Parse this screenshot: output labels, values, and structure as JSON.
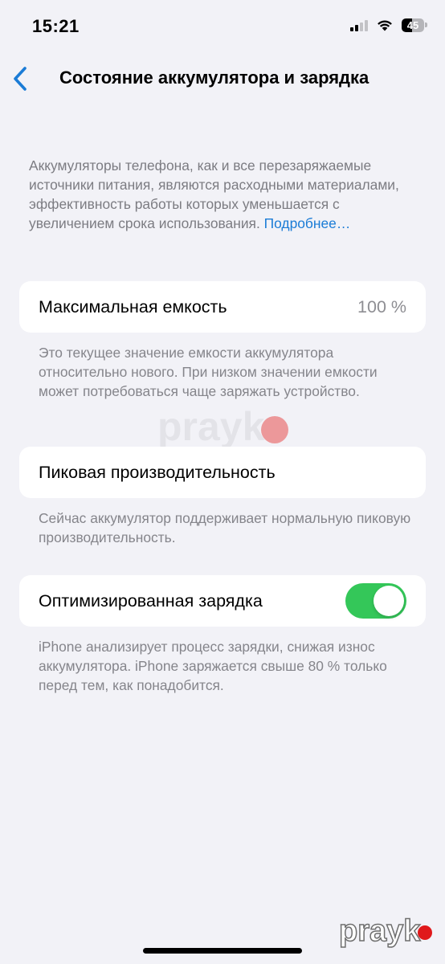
{
  "status_bar": {
    "time": "15:21",
    "battery_level": "45",
    "battery_fraction": 0.45,
    "signal_bars_active": 2,
    "signal_bars_total": 4,
    "icons": [
      "cellular-signal-icon",
      "wifi-icon",
      "battery-icon"
    ]
  },
  "nav": {
    "back_icon": "chevron-left-icon",
    "title": "Состояние аккумулятора и зарядка"
  },
  "intro": {
    "text": "Аккумуляторы телефона, как и все перезаряжаемые источники питания, являются расходными материалами, эффективность работы которых уменьшается с увеличением срока использования. ",
    "link": "Подробнее…"
  },
  "max_capacity": {
    "label": "Максимальная емкость",
    "value": "100 %",
    "footnote": "Это текущее значение емкости аккумулятора относительно нового. При низком значении емкости может потребоваться чаще заряжать устройство."
  },
  "peak_performance": {
    "label": "Пиковая производительность",
    "footnote": "Сейчас аккумулятор поддерживает нормальную пиковую производительность."
  },
  "optimized_charging": {
    "label": "Оптимизированная зарядка",
    "enabled": true,
    "footnote": "iPhone анализирует процесс зарядки, снижая износ аккумулятора. iPhone заряжается свыше 80 % только перед тем, как понадобится."
  },
  "watermarks": {
    "center_text": "prayk",
    "corner_text": "prayk"
  },
  "colors": {
    "background": "#f2f2f7",
    "card": "#ffffff",
    "accent_link": "#1b7cd6",
    "toggle_on": "#34c759",
    "secondary_text": "#85858b"
  }
}
